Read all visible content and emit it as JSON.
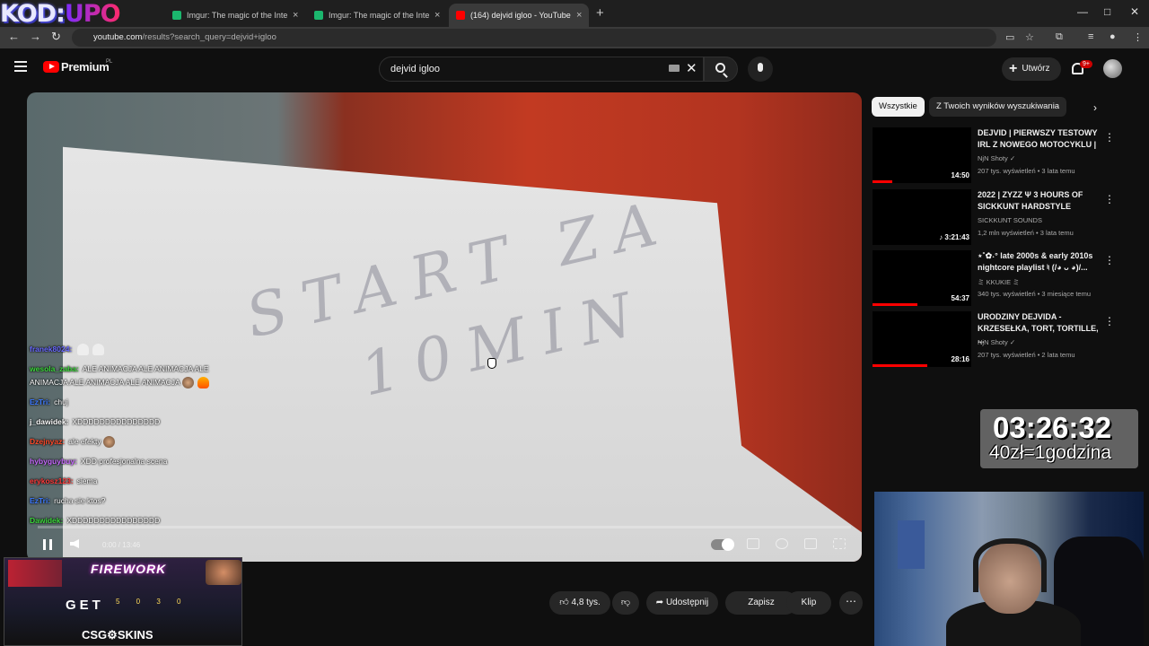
{
  "overlay_logo": {
    "part1": "KOD:",
    "part2": "UPO"
  },
  "browser": {
    "tabs": [
      {
        "title": "Imgur: The magic of the Interne",
        "color": "#1bb76e",
        "active": false
      },
      {
        "title": "Imgur: The magic of the Interne",
        "color": "#1bb76e",
        "active": false
      },
      {
        "title": "(164) dejvid igloo - YouTube",
        "color": "#ff0000",
        "active": true
      }
    ],
    "tab_close": "×",
    "new_tab": "+",
    "window_controls": [
      "—",
      "□",
      "✕"
    ],
    "url_host": "youtube.com",
    "url_path": "/results?search_query=dejvid+igloo"
  },
  "youtube": {
    "brand": "Premium",
    "region": "PL",
    "search_value": "dejvid igloo",
    "create_label": "Utwórz",
    "notifications": "9+"
  },
  "video": {
    "paper_line1": "START ZA",
    "paper_line2": "10MIN",
    "time": "0:00 / 13:46",
    "progress": 0
  },
  "chat": [
    {
      "user": "franek8024:",
      "color": "#6a6aff",
      "text": ""
    },
    {
      "user": "wesola_zaba:",
      "color": "#3dd83d",
      "text": "ALE ANIMACJA ALE ANIMACJA ALE ANIMACJA ALE ANIMACJA ALE ANIMACJA"
    },
    {
      "user": "EzTri:",
      "color": "#3d7aff",
      "text": "chuj"
    },
    {
      "user": "j_dawidek:",
      "color": "#ffffff",
      "text": "XDDDDDDDDDDDDDDD"
    },
    {
      "user": "Dzejnyaz:",
      "color": "#ff4a2a",
      "text": "ale efekty"
    },
    {
      "user": "hybyguybuy:",
      "color": "#c86aff",
      "text": "XDD profesjonalna scena"
    },
    {
      "user": "erykosz123:",
      "color": "#ff3a3a",
      "text": "siema"
    },
    {
      "user": "EzTri:",
      "color": "#3d7aff",
      "text": "rucha sie ktos?"
    },
    {
      "user": "Dawidek:",
      "color": "#3dd83d",
      "text": "XDDDDDDDDDDDDDDDD"
    }
  ],
  "ad": {
    "title": "FIREWORK",
    "get": "GET",
    "digits": "5 0 3 0",
    "brand": "CSG⚙SKINS"
  },
  "actions": {
    "like_count": "4,8 tys.",
    "share": "Udostępnij",
    "save": "Zapisz",
    "clip": "Klip",
    "more": "⋯"
  },
  "chips": [
    "Wszystkie",
    "Z Twoich wyników wyszukiwania"
  ],
  "recommendations": [
    {
      "title": "DEJVID | PIERWSZY TESTOWY IRL Z NOWEGO MOTOCYKLU |",
      "channel": "NjN Shoty ✓",
      "meta": "207 tys. wyświetleń • 3 lata temu",
      "duration": "14:50",
      "watched": 0.2
    },
    {
      "title": "2022 | ZYZZ Ψ 3 HOURS OF SICKKUNT HARDSTYLE",
      "channel": "SICKKUNT SOUNDS",
      "meta": "1,2 mln wyświetleń • 3 lata temu",
      "duration": "♪ 3:21:43",
      "watched": 0
    },
    {
      "title": "⋆˚✿˖° late 2000s & early 2010s nightcore playlist ♮ (/◕ ᴗ ◕)/...",
      "channel": "ミ KKUKIE ミ",
      "meta": "340 tys. wyświetleń • 3 miesiące temu",
      "duration": "54:37",
      "watched": 0.45
    },
    {
      "title": "URODZINY DEJVIDA - KRZESEŁKA, TORT, TORTILLE, ...",
      "channel": "NjN Shoty ✓",
      "meta": "207 tys. wyświetleń • 2 lata temu",
      "duration": "28:16",
      "watched": 0.55
    }
  ],
  "timer": {
    "time": "03:26:32",
    "rate": "40zł=1godzina"
  }
}
